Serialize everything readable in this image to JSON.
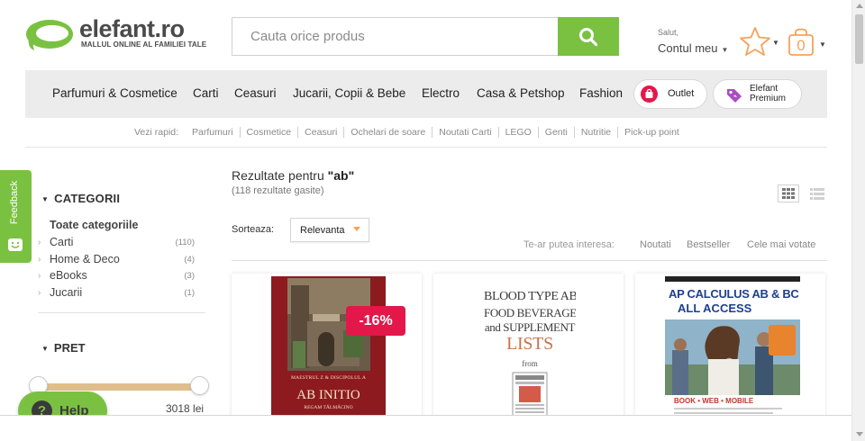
{
  "header": {
    "brand": "elefant.ro",
    "tagline": "MALLUL ONLINE AL FAMILIEI TALE",
    "brand_color": "#7ac142",
    "search_placeholder": "Cauta orice produs",
    "greeting": "Salut,",
    "account_label": "Contul meu",
    "cart_count": "0"
  },
  "nav": {
    "items": [
      "Parfumuri & Cosmetice",
      "Carti",
      "Ceasuri",
      "Jucarii, Copii & Bebe",
      "Electro",
      "Casa & Petshop",
      "Fashion"
    ],
    "outlet": "Outlet",
    "premium_line1": "Elefant",
    "premium_line2": "Premium"
  },
  "quick": {
    "label": "Vezi rapid:",
    "links": [
      "Parfumuri",
      "Cosmetice",
      "Ceasuri",
      "Ochelari de soare",
      "Noutati Carti",
      "LEGO",
      "Genti",
      "Nutritie",
      "Pick-up point"
    ]
  },
  "feedback": "Feedback",
  "sidebar": {
    "categories_title": "CATEGORII",
    "all_categories": "Toate categoriile",
    "categories": [
      {
        "name": "Carti",
        "count": "(110)"
      },
      {
        "name": "Home & Deco",
        "count": "(4)"
      },
      {
        "name": "eBooks",
        "count": "(3)"
      },
      {
        "name": "Jucarii",
        "count": "(1)"
      }
    ],
    "price_title": "PRET",
    "price_max": "3018 lei"
  },
  "help": "Help",
  "results": {
    "title_prefix": "Rezultate pentru ",
    "query": "\"ab\"",
    "count_text": "(118 rezultate gasite)",
    "sort_label": "Sorteaza:",
    "sort_value": "Relevanta",
    "interest_label": "Te-ar putea interesa:",
    "interest_links": [
      "Noutati",
      "Bestseller",
      "Cele mai votate"
    ]
  },
  "products": [
    {
      "discount": "-16%",
      "cover_line1": "MAESTRUL Z & DISCIPOLUL A",
      "cover_title": "AB INITIO",
      "cover_sub": "REGAM TĂLMĂCINO"
    },
    {
      "cover_line1": "BLOOD TYPE AB",
      "cover_line2": "FOOD BEVERAGE",
      "cover_line3": "and SUPPLEMENT",
      "cover_line4": "LISTS",
      "cover_line5": "from"
    },
    {
      "cover_line1": "AP CALCULUS AB & BC",
      "cover_line2": "ALL ACCESS",
      "cover_line3": "BOOK • WEB • MOBILE"
    }
  ]
}
